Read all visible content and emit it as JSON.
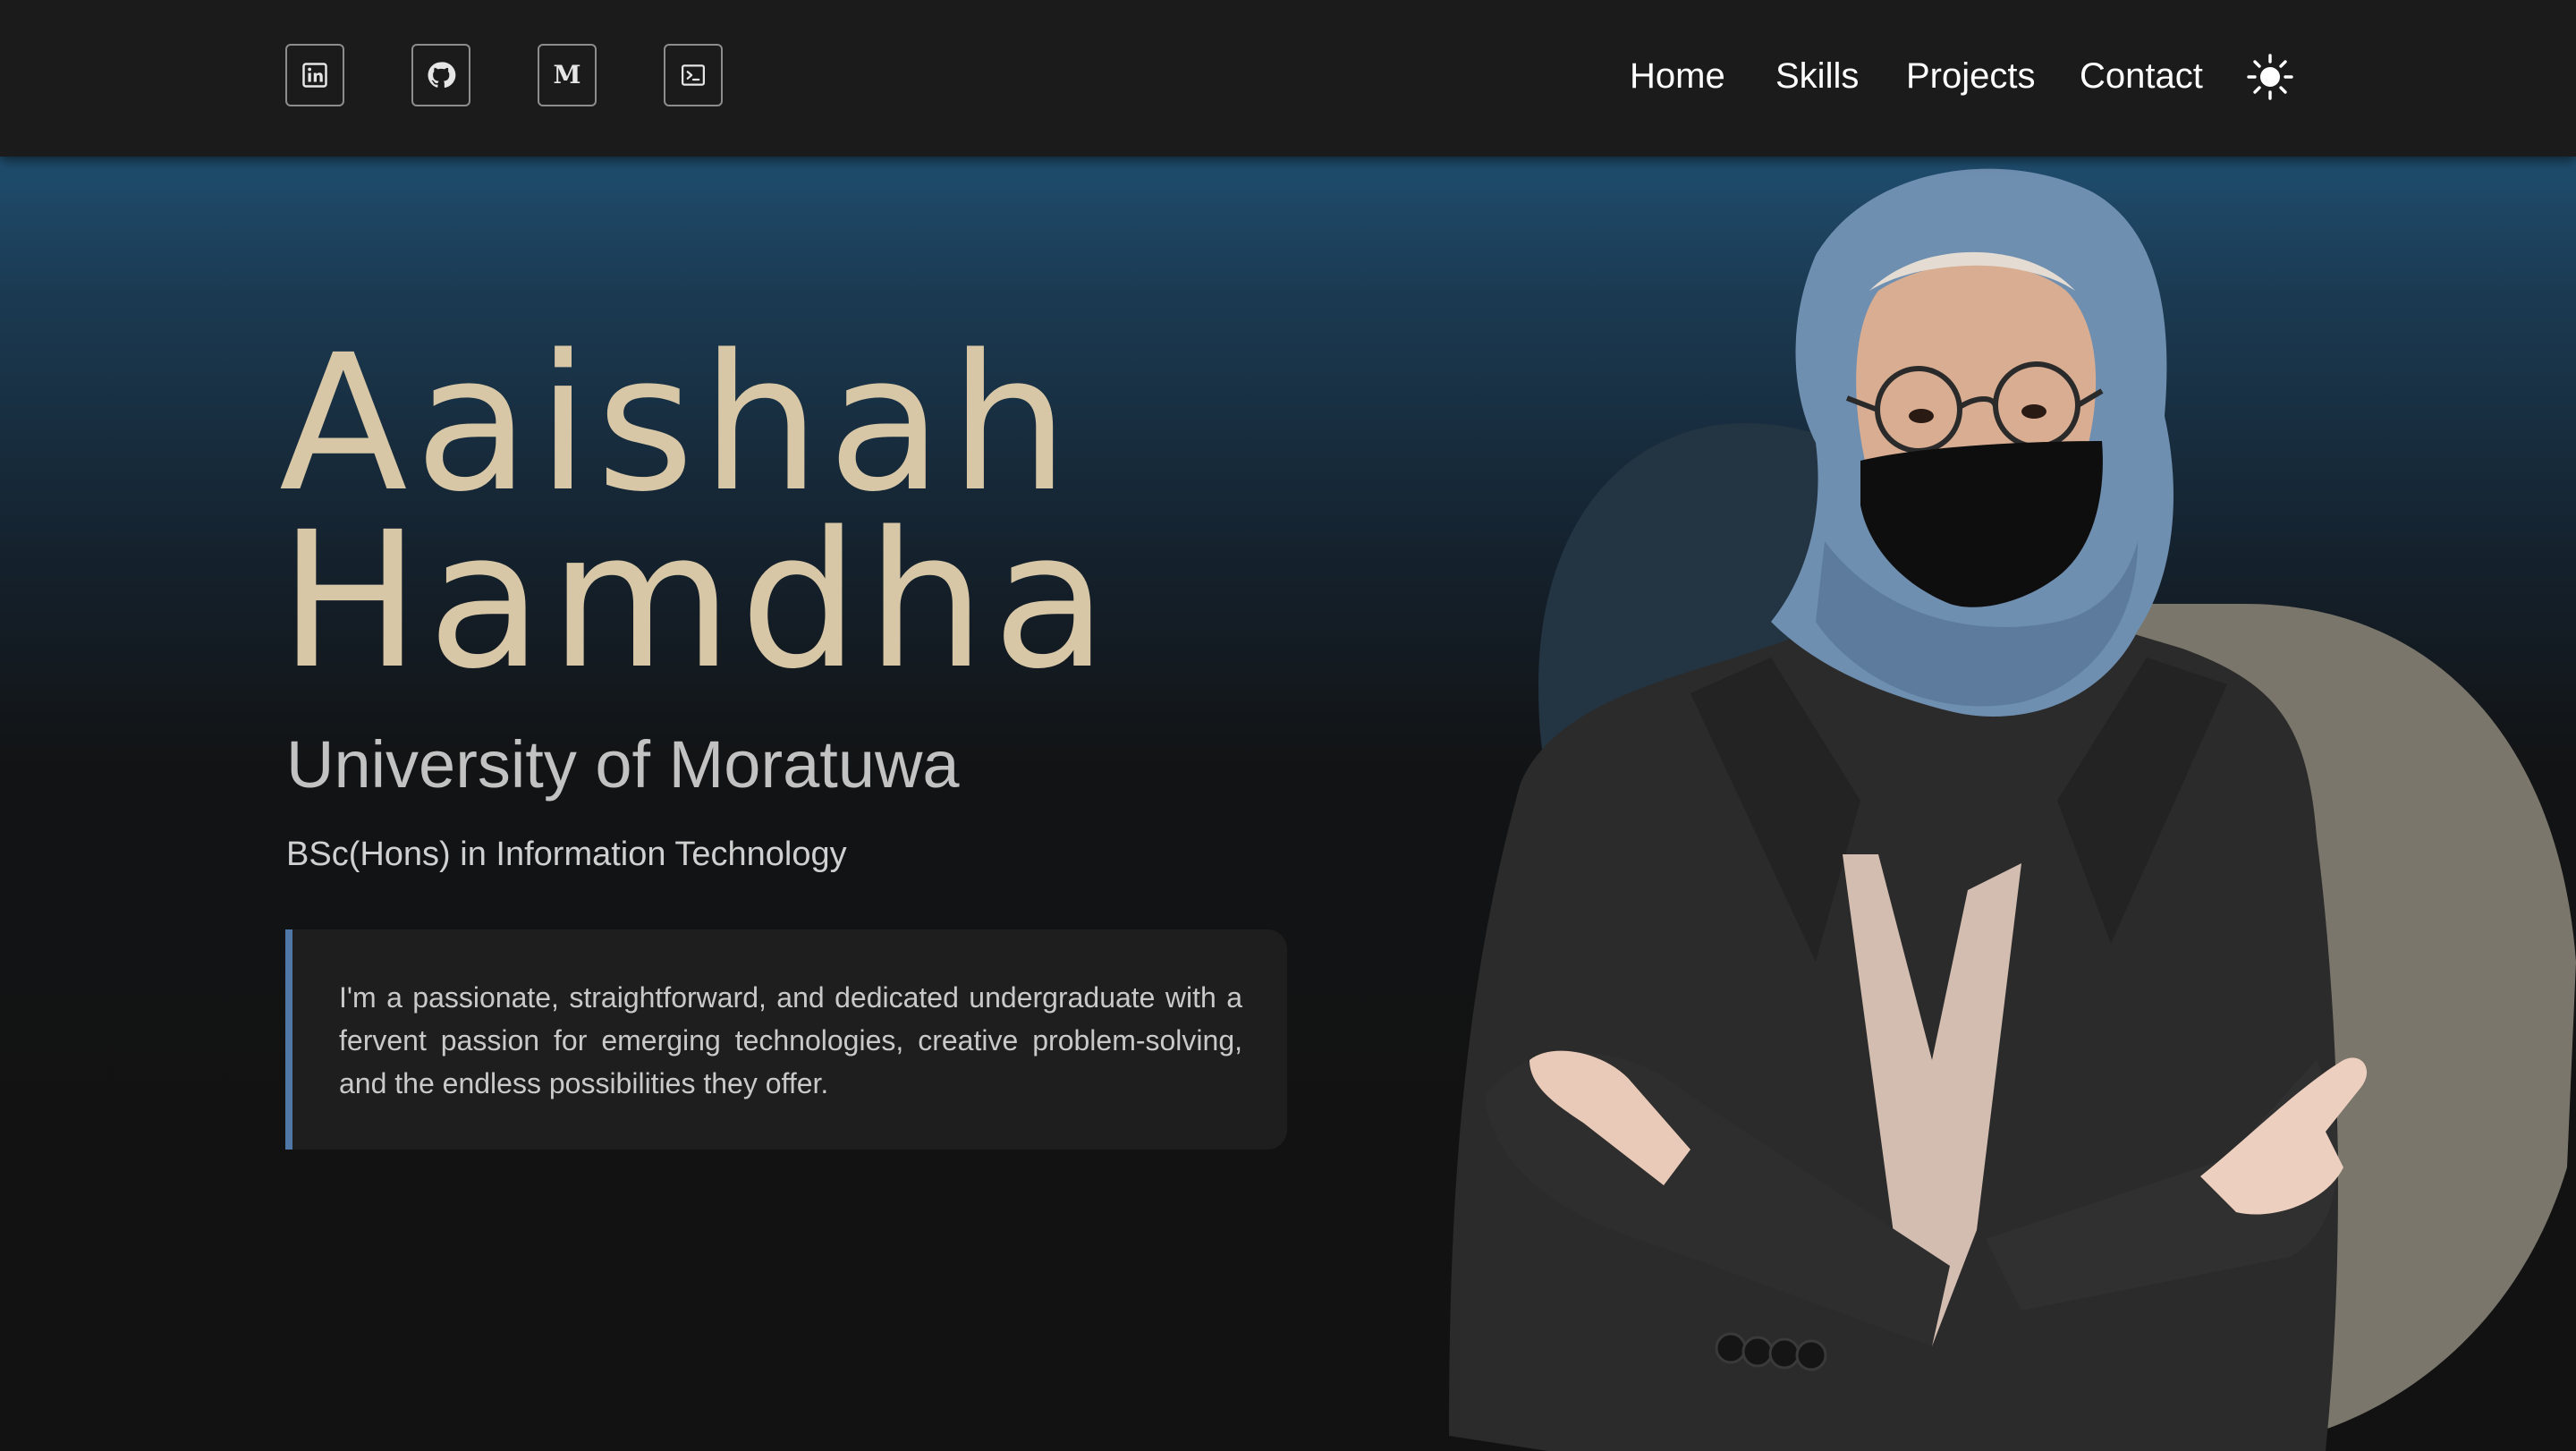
{
  "header": {
    "social_links": [
      {
        "name": "LinkedIn",
        "icon": "linkedin-icon"
      },
      {
        "name": "GitHub",
        "icon": "github-icon"
      },
      {
        "name": "Medium",
        "icon": "medium-icon",
        "glyph": "M"
      },
      {
        "name": "Terminal",
        "icon": "terminal-icon"
      }
    ],
    "nav": [
      {
        "label": "Home"
      },
      {
        "label": "Skills"
      },
      {
        "label": "Projects"
      },
      {
        "label": "Contact"
      }
    ],
    "theme_toggle_icon": "sun-icon"
  },
  "hero": {
    "first_name": "Aaishah",
    "last_name": "Hamdha",
    "university": "University of Moratuwa",
    "degree": "BSc(Hons) in Information Technology",
    "bio": "I'm a passionate, straightforward, and dedicated undergraduate with a fervent passion for emerging technologies, creative problem-solving, and the endless possibilities they offer."
  },
  "colors": {
    "header_bg": "#1b1b1b",
    "hero_gradient_top": "#1f4d6e",
    "page_bg": "#121212",
    "name_color": "#d7c7a6",
    "accent_bar": "#4f78a6",
    "blob": "#7a766b"
  }
}
